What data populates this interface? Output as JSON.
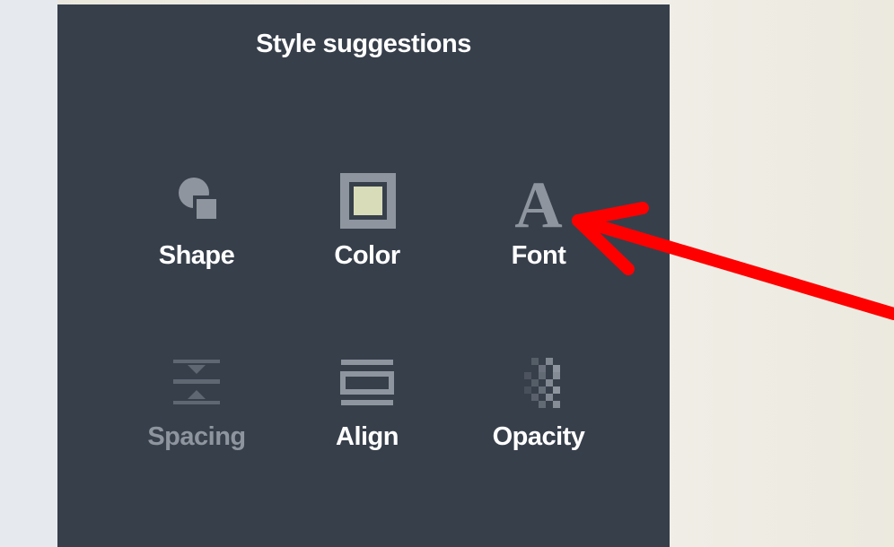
{
  "panel": {
    "title": "Style suggestions"
  },
  "tools": [
    {
      "label": "Shape",
      "icon": "shape-icon",
      "enabled": true
    },
    {
      "label": "Color",
      "icon": "color-swatch-icon",
      "enabled": true
    },
    {
      "label": "Font",
      "icon": "font-icon",
      "enabled": true
    },
    {
      "label": "Spacing",
      "icon": "spacing-icon",
      "enabled": false
    },
    {
      "label": "Align",
      "icon": "align-icon",
      "enabled": true
    },
    {
      "label": "Opacity",
      "icon": "opacity-icon",
      "enabled": true
    }
  ],
  "colors": {
    "panel_background": "#373f4b",
    "icon_gray": "#8e959e",
    "color_swatch_fill": "#d8dcb8",
    "annotation_arrow": "#ff0000"
  },
  "annotation": {
    "type": "arrow",
    "points_to": "Font"
  }
}
